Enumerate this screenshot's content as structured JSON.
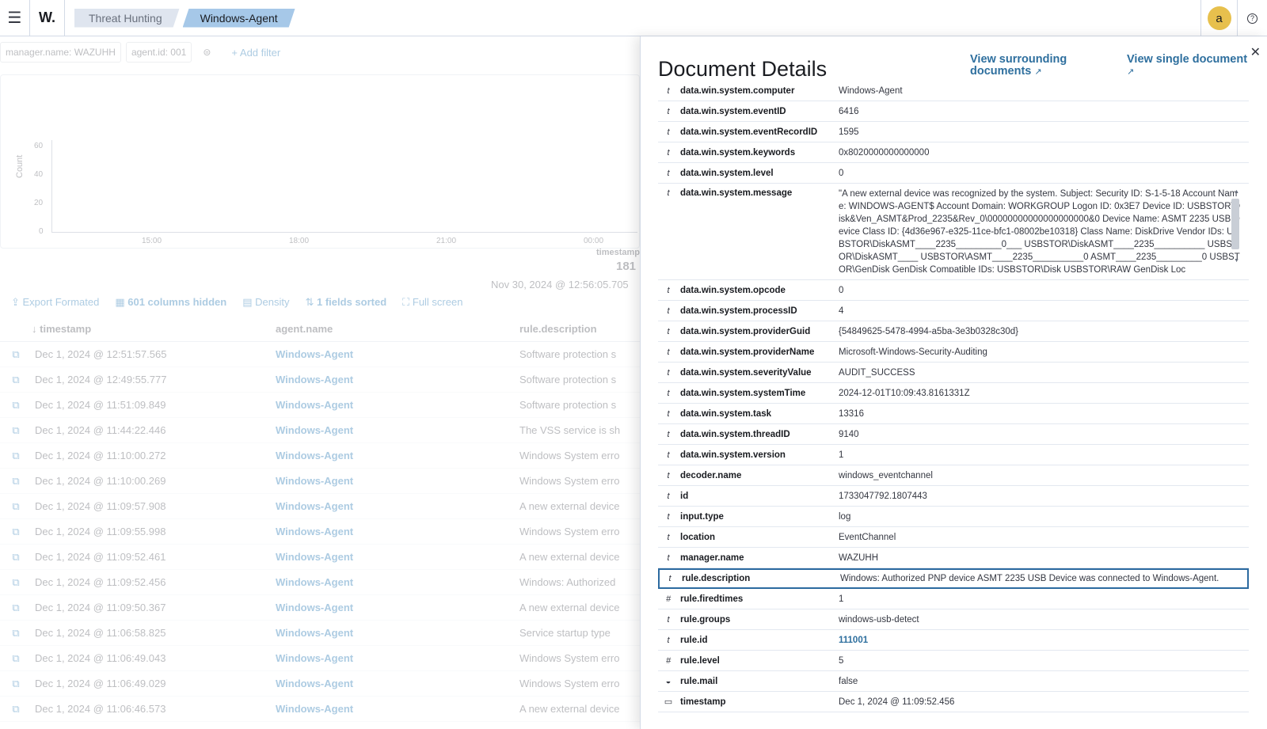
{
  "header": {
    "logo": "W.",
    "breadcrumbs": [
      "Threat Hunting",
      "Windows-Agent"
    ],
    "avatar_initial": "a"
  },
  "filters": {
    "pills": [
      "manager.name: WAZUHH",
      "agent.id: 001"
    ],
    "add_filter": "+ Add filter"
  },
  "chart": {
    "ylabel": "Count",
    "yticks": [
      "60",
      "40",
      "20",
      "0"
    ],
    "xticks": [
      "15:00",
      "18:00",
      "21:00",
      "00:00"
    ],
    "xlabel": "timestamp"
  },
  "hits": {
    "count": "181",
    "range": "Nov 30, 2024 @ 12:56:05.705"
  },
  "toolbar": {
    "export": "Export Formated",
    "columns_hidden": "601 columns hidden",
    "density": "Density",
    "sorted": "1 fields sorted",
    "fullscreen": "Full screen"
  },
  "table": {
    "headers": [
      "timestamp",
      "agent.name",
      "rule.description"
    ],
    "rows": [
      {
        "ts": "Dec 1, 2024 @ 12:51:57.565",
        "agent": "Windows-Agent",
        "desc": "Software protection s"
      },
      {
        "ts": "Dec 1, 2024 @ 12:49:55.777",
        "agent": "Windows-Agent",
        "desc": "Software protection s"
      },
      {
        "ts": "Dec 1, 2024 @ 11:51:09.849",
        "agent": "Windows-Agent",
        "desc": "Software protection s"
      },
      {
        "ts": "Dec 1, 2024 @ 11:44:22.446",
        "agent": "Windows-Agent",
        "desc": "The VSS service is sh"
      },
      {
        "ts": "Dec 1, 2024 @ 11:10:00.272",
        "agent": "Windows-Agent",
        "desc": "Windows System erro"
      },
      {
        "ts": "Dec 1, 2024 @ 11:10:00.269",
        "agent": "Windows-Agent",
        "desc": "Windows System erro"
      },
      {
        "ts": "Dec 1, 2024 @ 11:09:57.908",
        "agent": "Windows-Agent",
        "desc": "A new external device"
      },
      {
        "ts": "Dec 1, 2024 @ 11:09:55.998",
        "agent": "Windows-Agent",
        "desc": "Windows System erro"
      },
      {
        "ts": "Dec 1, 2024 @ 11:09:52.461",
        "agent": "Windows-Agent",
        "desc": "A new external device"
      },
      {
        "ts": "Dec 1, 2024 @ 11:09:52.456",
        "agent": "Windows-Agent",
        "desc": "Windows: Authorized"
      },
      {
        "ts": "Dec 1, 2024 @ 11:09:50.367",
        "agent": "Windows-Agent",
        "desc": "A new external device"
      },
      {
        "ts": "Dec 1, 2024 @ 11:06:58.825",
        "agent": "Windows-Agent",
        "desc": "Service startup type"
      },
      {
        "ts": "Dec 1, 2024 @ 11:06:49.043",
        "agent": "Windows-Agent",
        "desc": "Windows System erro"
      },
      {
        "ts": "Dec 1, 2024 @ 11:06:49.029",
        "agent": "Windows-Agent",
        "desc": "Windows System erro"
      },
      {
        "ts": "Dec 1, 2024 @ 11:06:46.573",
        "agent": "Windows-Agent",
        "desc": "A new external device"
      }
    ]
  },
  "flyout": {
    "title": "Document Details",
    "link_surrounding": "View surrounding documents",
    "link_single": "View single document",
    "fields": [
      {
        "type": "t",
        "key": "data.win.system.computer",
        "value": "Windows-Agent"
      },
      {
        "type": "t",
        "key": "data.win.system.eventID",
        "value": "6416"
      },
      {
        "type": "t",
        "key": "data.win.system.eventRecordID",
        "value": "1595"
      },
      {
        "type": "t",
        "key": "data.win.system.keywords",
        "value": "0x8020000000000000"
      },
      {
        "type": "t",
        "key": "data.win.system.level",
        "value": "0"
      },
      {
        "type": "t",
        "key": "data.win.system.message",
        "value": "\"A new external device was recognized by the system. Subject: Security ID: S-1-5-18 Account Name: WINDOWS-AGENT$ Account Domain: WORKGROUP Logon ID: 0x3E7 Device ID: USBSTOR\\Disk&Ven_ASMT&Prod_2235&Rev_0\\00000000000000000000&0 Device Name: ASMT 2235 USB Device Class ID: {4d36e967-e325-11ce-bfc1-08002be10318} Class Name: DiskDrive Vendor IDs: USBSTOR\\DiskASMT____2235_________0___ USBSTOR\\DiskASMT____2235__________ USBSTOR\\DiskASMT____ USBSTOR\\ASMT____2235__________0 ASMT____2235_________0 USBSTOR\\GenDisk GenDisk Compatible IDs: USBSTOR\\Disk USBSTOR\\RAW GenDisk Loc"
      },
      {
        "type": "t",
        "key": "data.win.system.opcode",
        "value": "0"
      },
      {
        "type": "t",
        "key": "data.win.system.processID",
        "value": "4"
      },
      {
        "type": "t",
        "key": "data.win.system.providerGuid",
        "value": "{54849625-5478-4994-a5ba-3e3b0328c30d}"
      },
      {
        "type": "t",
        "key": "data.win.system.providerName",
        "value": "Microsoft-Windows-Security-Auditing"
      },
      {
        "type": "t",
        "key": "data.win.system.severityValue",
        "value": "AUDIT_SUCCESS"
      },
      {
        "type": "t",
        "key": "data.win.system.systemTime",
        "value": "2024-12-01T10:09:43.8161331Z"
      },
      {
        "type": "t",
        "key": "data.win.system.task",
        "value": "13316"
      },
      {
        "type": "t",
        "key": "data.win.system.threadID",
        "value": "9140"
      },
      {
        "type": "t",
        "key": "data.win.system.version",
        "value": "1"
      },
      {
        "type": "t",
        "key": "decoder.name",
        "value": "windows_eventchannel"
      },
      {
        "type": "t",
        "key": "id",
        "value": "1733047792.1807443"
      },
      {
        "type": "t",
        "key": "input.type",
        "value": "log"
      },
      {
        "type": "t",
        "key": "location",
        "value": "EventChannel"
      },
      {
        "type": "t",
        "key": "manager.name",
        "value": "WAZUHH"
      },
      {
        "type": "t",
        "key": "rule.description",
        "value": "Windows: Authorized PNP device ASMT 2235 USB Device was connected to Windows-Agent."
      },
      {
        "type": "#",
        "key": "rule.firedtimes",
        "value": "1"
      },
      {
        "type": "t",
        "key": "rule.groups",
        "value": "windows-usb-detect"
      },
      {
        "type": "t",
        "key": "rule.id",
        "value": "111001"
      },
      {
        "type": "#",
        "key": "rule.level",
        "value": "5"
      },
      {
        "type": "bool",
        "key": "rule.mail",
        "value": "false"
      },
      {
        "type": "date",
        "key": "timestamp",
        "value": "Dec 1, 2024 @ 11:09:52.456"
      }
    ]
  },
  "colors": {
    "accent": "#2e6f9e",
    "highlight_border": "#2c6aa0",
    "avatar": "#e7c04d",
    "breadcrumb_active": "#a6c8e8"
  }
}
